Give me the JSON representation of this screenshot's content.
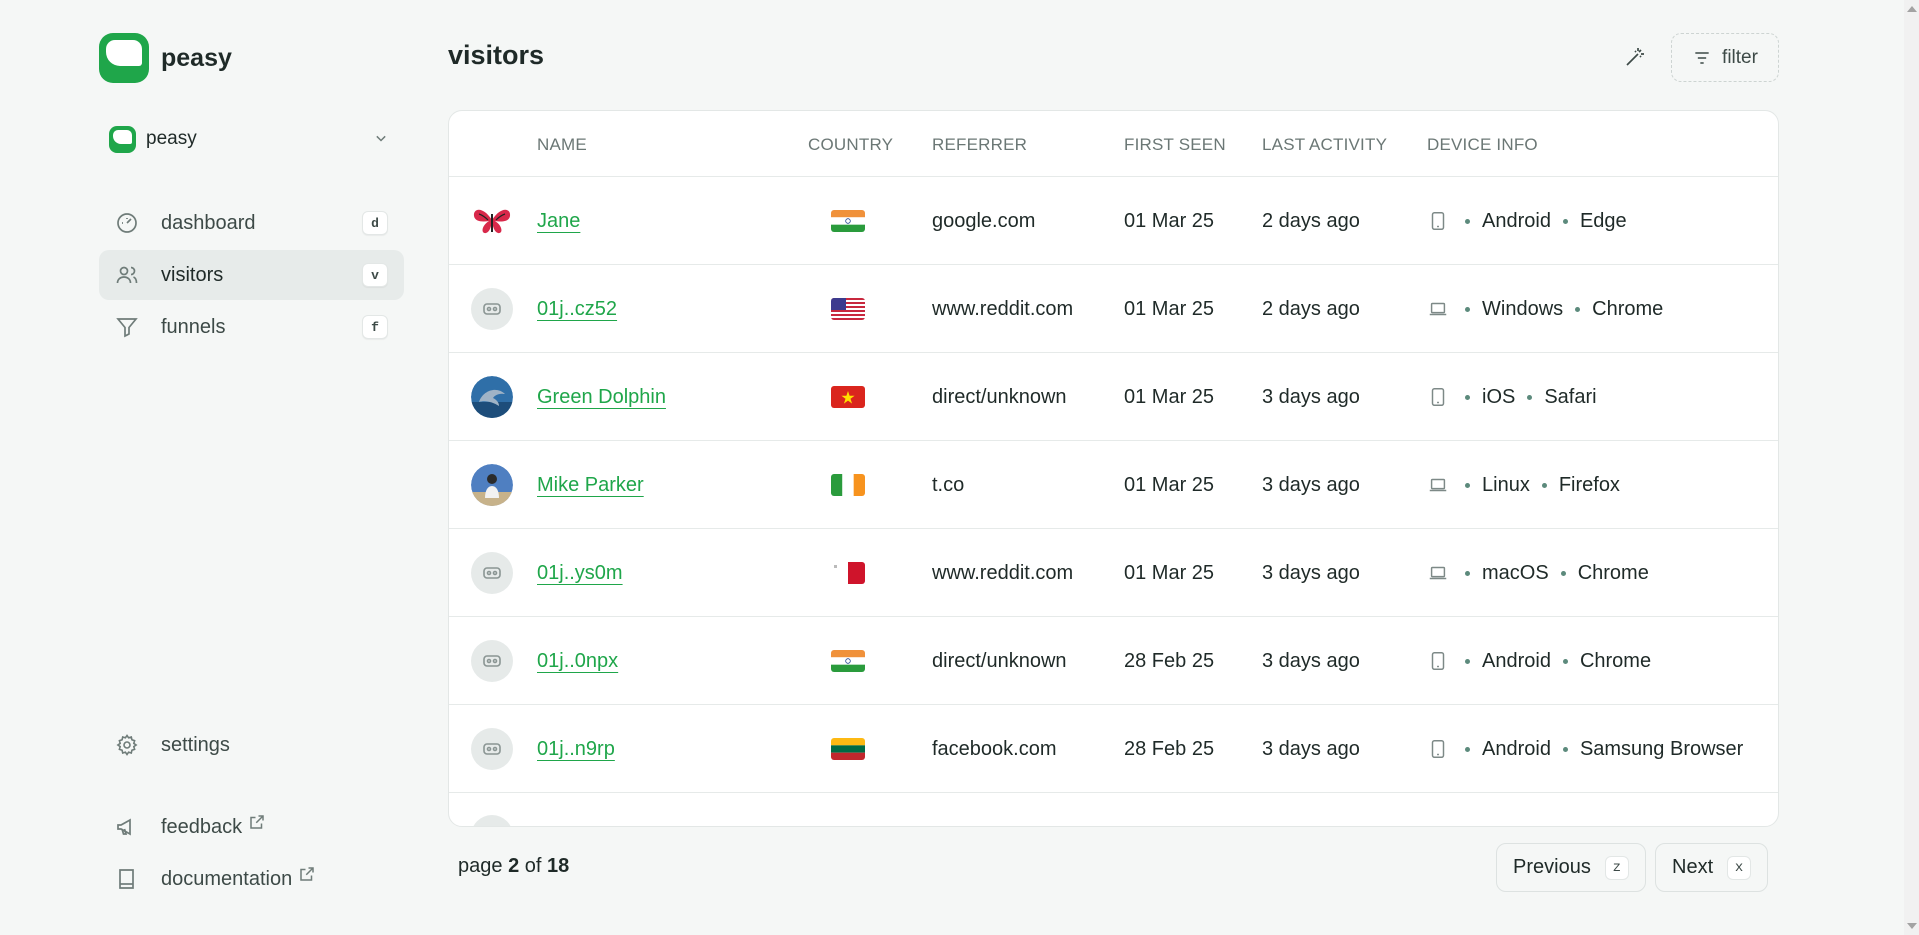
{
  "brand": {
    "name": "peasy"
  },
  "project": {
    "name": "peasy"
  },
  "nav": [
    {
      "label": "dashboard",
      "shortcut": "d",
      "icon": "gauge-icon",
      "active": false
    },
    {
      "label": "visitors",
      "shortcut": "v",
      "icon": "users-icon",
      "active": true
    },
    {
      "label": "funnels",
      "shortcut": "f",
      "icon": "funnel-icon",
      "active": false
    }
  ],
  "bottom_nav": {
    "settings": "settings",
    "feedback": "feedback",
    "documentation": "documentation"
  },
  "header": {
    "title": "visitors",
    "filter_label": "filter"
  },
  "table": {
    "columns": [
      "NAME",
      "COUNTRY",
      "REFERRER",
      "FIRST SEEN",
      "LAST ACTIVITY",
      "DEVICE INFO"
    ],
    "rows": [
      {
        "name": "Jane",
        "avatar": "butterfly",
        "country": "India",
        "referrer": "google.com",
        "first_seen": "01 Mar 25",
        "last_activity": "2 days ago",
        "device": "mobile",
        "os": "Android",
        "browser": "Edge"
      },
      {
        "name": "01j..cz52",
        "avatar": "anon",
        "country": "United States",
        "referrer": "www.reddit.com",
        "first_seen": "01 Mar 25",
        "last_activity": "2 days ago",
        "device": "laptop",
        "os": "Windows",
        "browser": "Chrome"
      },
      {
        "name": "Green Dolphin",
        "avatar": "dolphin",
        "country": "Vietnam",
        "referrer": "direct/unknown",
        "first_seen": "01 Mar 25",
        "last_activity": "3 days ago",
        "device": "mobile",
        "os": "iOS",
        "browser": "Safari"
      },
      {
        "name": "Mike Parker",
        "avatar": "person",
        "country": "Ireland",
        "referrer": "t.co",
        "first_seen": "01 Mar 25",
        "last_activity": "3 days ago",
        "device": "laptop",
        "os": "Linux",
        "browser": "Firefox"
      },
      {
        "name": "01j..ys0m",
        "avatar": "anon",
        "country": "Malta",
        "referrer": "www.reddit.com",
        "first_seen": "01 Mar 25",
        "last_activity": "3 days ago",
        "device": "laptop",
        "os": "macOS",
        "browser": "Chrome"
      },
      {
        "name": "01j..0npx",
        "avatar": "anon",
        "country": "India",
        "referrer": "direct/unknown",
        "first_seen": "28 Feb 25",
        "last_activity": "3 days ago",
        "device": "mobile",
        "os": "Android",
        "browser": "Chrome"
      },
      {
        "name": "01j..n9rp",
        "avatar": "anon",
        "country": "Lithuania",
        "referrer": "facebook.com",
        "first_seen": "28 Feb 25",
        "last_activity": "3 days ago",
        "device": "mobile",
        "os": "Android",
        "browser": "Samsung Browser"
      }
    ]
  },
  "pagination": {
    "prefix": "page",
    "current": "2",
    "of": "of",
    "total": "18",
    "previous_label": "Previous",
    "previous_shortcut": "z",
    "next_label": "Next",
    "next_shortcut": "x"
  },
  "colors": {
    "accent": "#1fa64a",
    "background": "#f5f7f6"
  }
}
